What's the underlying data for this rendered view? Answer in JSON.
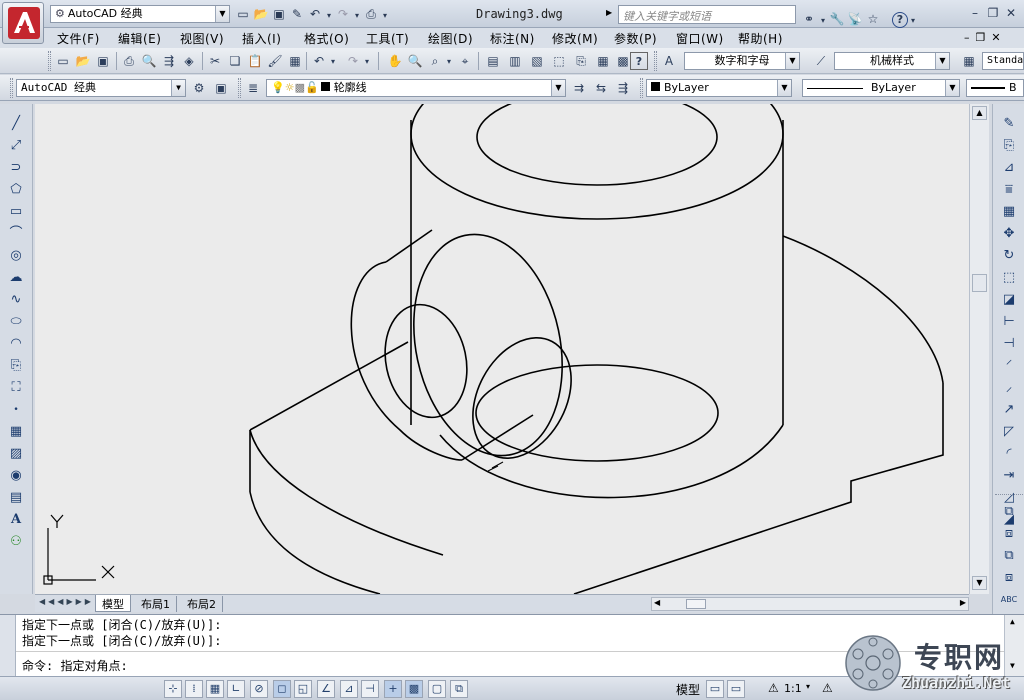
{
  "title": {
    "workspace": "AutoCAD 经典",
    "document": "Drawing3.dwg",
    "search_placeholder": "键入关键字或短语"
  },
  "menu": [
    "文件(F)",
    "编辑(E)",
    "视图(V)",
    "插入(I)",
    "格式(O)",
    "工具(T)",
    "绘图(D)",
    "标注(N)",
    "修改(M)",
    "参数(P)",
    "窗口(W)",
    "帮助(H)"
  ],
  "styles": {
    "text_style": "数字和字母",
    "dim_style": "机械样式",
    "table_style": "Standa"
  },
  "layers": {
    "workspace": "AutoCAD 经典",
    "layer": "轮廓线",
    "color": "ByLayer",
    "linetype": "ByLayer",
    "lineweight": "B"
  },
  "ucs": {
    "x": "X",
    "y": "Y"
  },
  "tabs": [
    "模型",
    "布局1",
    "布局2"
  ],
  "command": {
    "line1": "指定下一点或 [闭合(C)/放弃(U)]:",
    "line2": "指定下一点或 [闭合(C)/放弃(U)]:",
    "line3": "命令: 指定对角点:"
  },
  "status": {
    "model": "模型",
    "scale": "1:1"
  },
  "watermark": {
    "cn": "专职网",
    "url": "Zhuanzhi.Net"
  },
  "colors": {
    "accent": "#c4262e",
    "canvas_bg": "#ebebeb",
    "ui_bg": "#d6dce5"
  }
}
